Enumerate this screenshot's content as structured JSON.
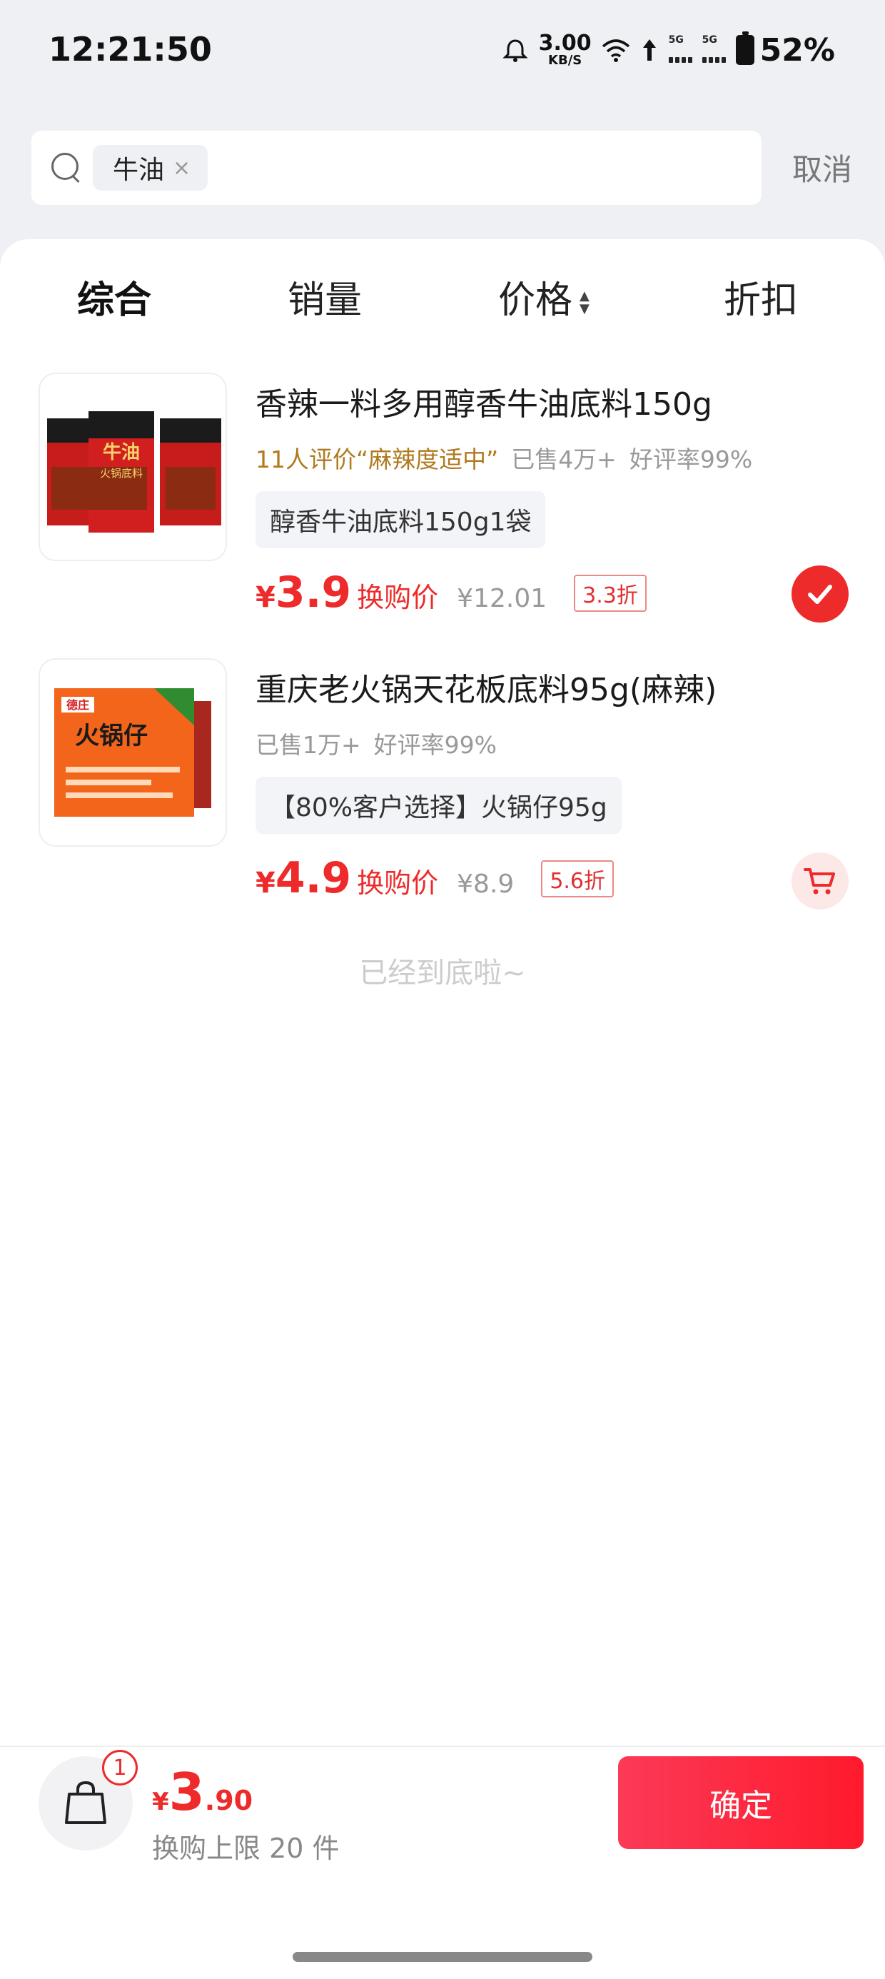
{
  "status_bar": {
    "time": "12:21:50",
    "net_speed_value": "3.00",
    "net_speed_unit": "KB/S",
    "sim1_label": "5G",
    "sim2_label": "5G",
    "battery": "52%"
  },
  "search": {
    "chip_text": "牛油",
    "chip_close": "×",
    "cancel_label": "取消"
  },
  "sort_tabs": {
    "comprehensive": "综合",
    "sales": "销量",
    "price": "价格",
    "discount": "折扣",
    "price_arrow_up": "▲",
    "price_arrow_down": "▼"
  },
  "products": [
    {
      "title": "香辣一料多用醇香牛油底料150g",
      "review": "11人评价“麻辣度适中”",
      "sold": "已售4万+",
      "rating": "好评率99%",
      "spec": "醇香牛油底料150g1袋",
      "price_symbol": "¥",
      "price": "3.9",
      "price_label": "换购价",
      "original_price": "¥12.01",
      "discount": "3.3折",
      "selected": true,
      "image_text_1": "牛油",
      "image_text_2": "火锅底料"
    },
    {
      "title": "重庆老火锅天花板底料95g(麻辣)",
      "sold": "已售1万+",
      "rating": "好评率99%",
      "spec": "【80%客户选择】火锅仔95g",
      "price_symbol": "¥",
      "price": "4.9",
      "price_label": "换购价",
      "original_price": "¥8.9",
      "discount": "5.6折",
      "selected": false,
      "image_text_1": "火锅仔",
      "image_brand": "德庄"
    }
  ],
  "end_text": "已经到底啦~",
  "bottom_bar": {
    "badge_count": "1",
    "total_symbol": "¥",
    "total_int": "3",
    "total_dec": ".90",
    "limit_text": "换购上限 20 件",
    "confirm_label": "确定"
  },
  "colors": {
    "accent_red": "#ee2a2a",
    "background": "#eef0f4",
    "review_gold": "#b07a1e"
  }
}
